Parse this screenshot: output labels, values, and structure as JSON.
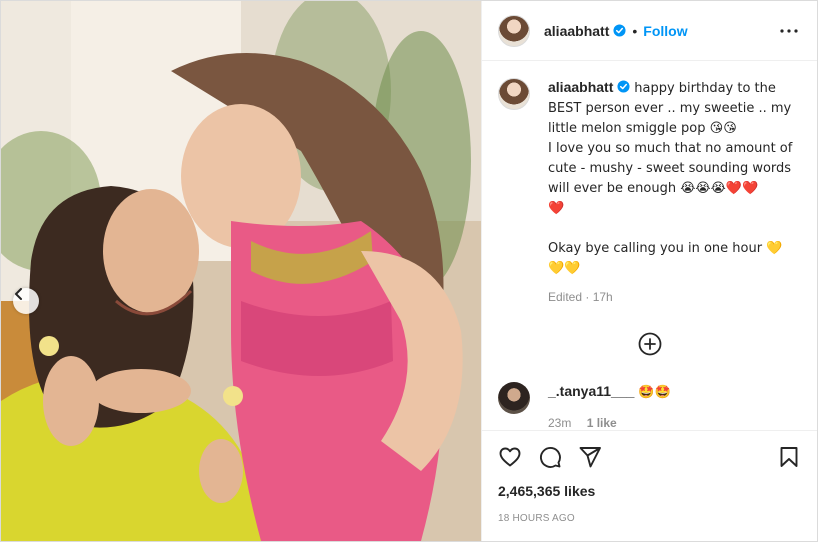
{
  "post": {
    "author": "aliaabhatt",
    "follow_label": "Follow",
    "dot": "•",
    "caption": "happy birthday to the BEST person ever .. my sweetie .. my little melon smiggle pop 😘😘\nI love you so much that no amount of cute - mushy - sweet sounding words will ever be enough 😭😭😭❤️❤️\n❤️\n\nOkay bye calling you in one hour 💛\n💛💛",
    "caption_meta": "Edited · 17h",
    "likes": "2,465,365 likes",
    "time_ago": "18 HOURS AGO"
  },
  "comments": [
    {
      "username": "_.tanya11___",
      "text": "🤩🤩",
      "age": "23m",
      "likes": "1 like"
    }
  ],
  "icons": {
    "more": "more-options-icon",
    "verified": "verified-badge-icon",
    "load_more": "plus-circle-icon",
    "like": "heart-icon",
    "comment": "comment-icon",
    "share": "share-icon",
    "save": "bookmark-icon",
    "carousel_prev": "chevron-left-icon"
  },
  "colors": {
    "accent": "#0095f6",
    "verified": "#0095f6",
    "text": "#262626",
    "muted": "#8e8e8e"
  }
}
